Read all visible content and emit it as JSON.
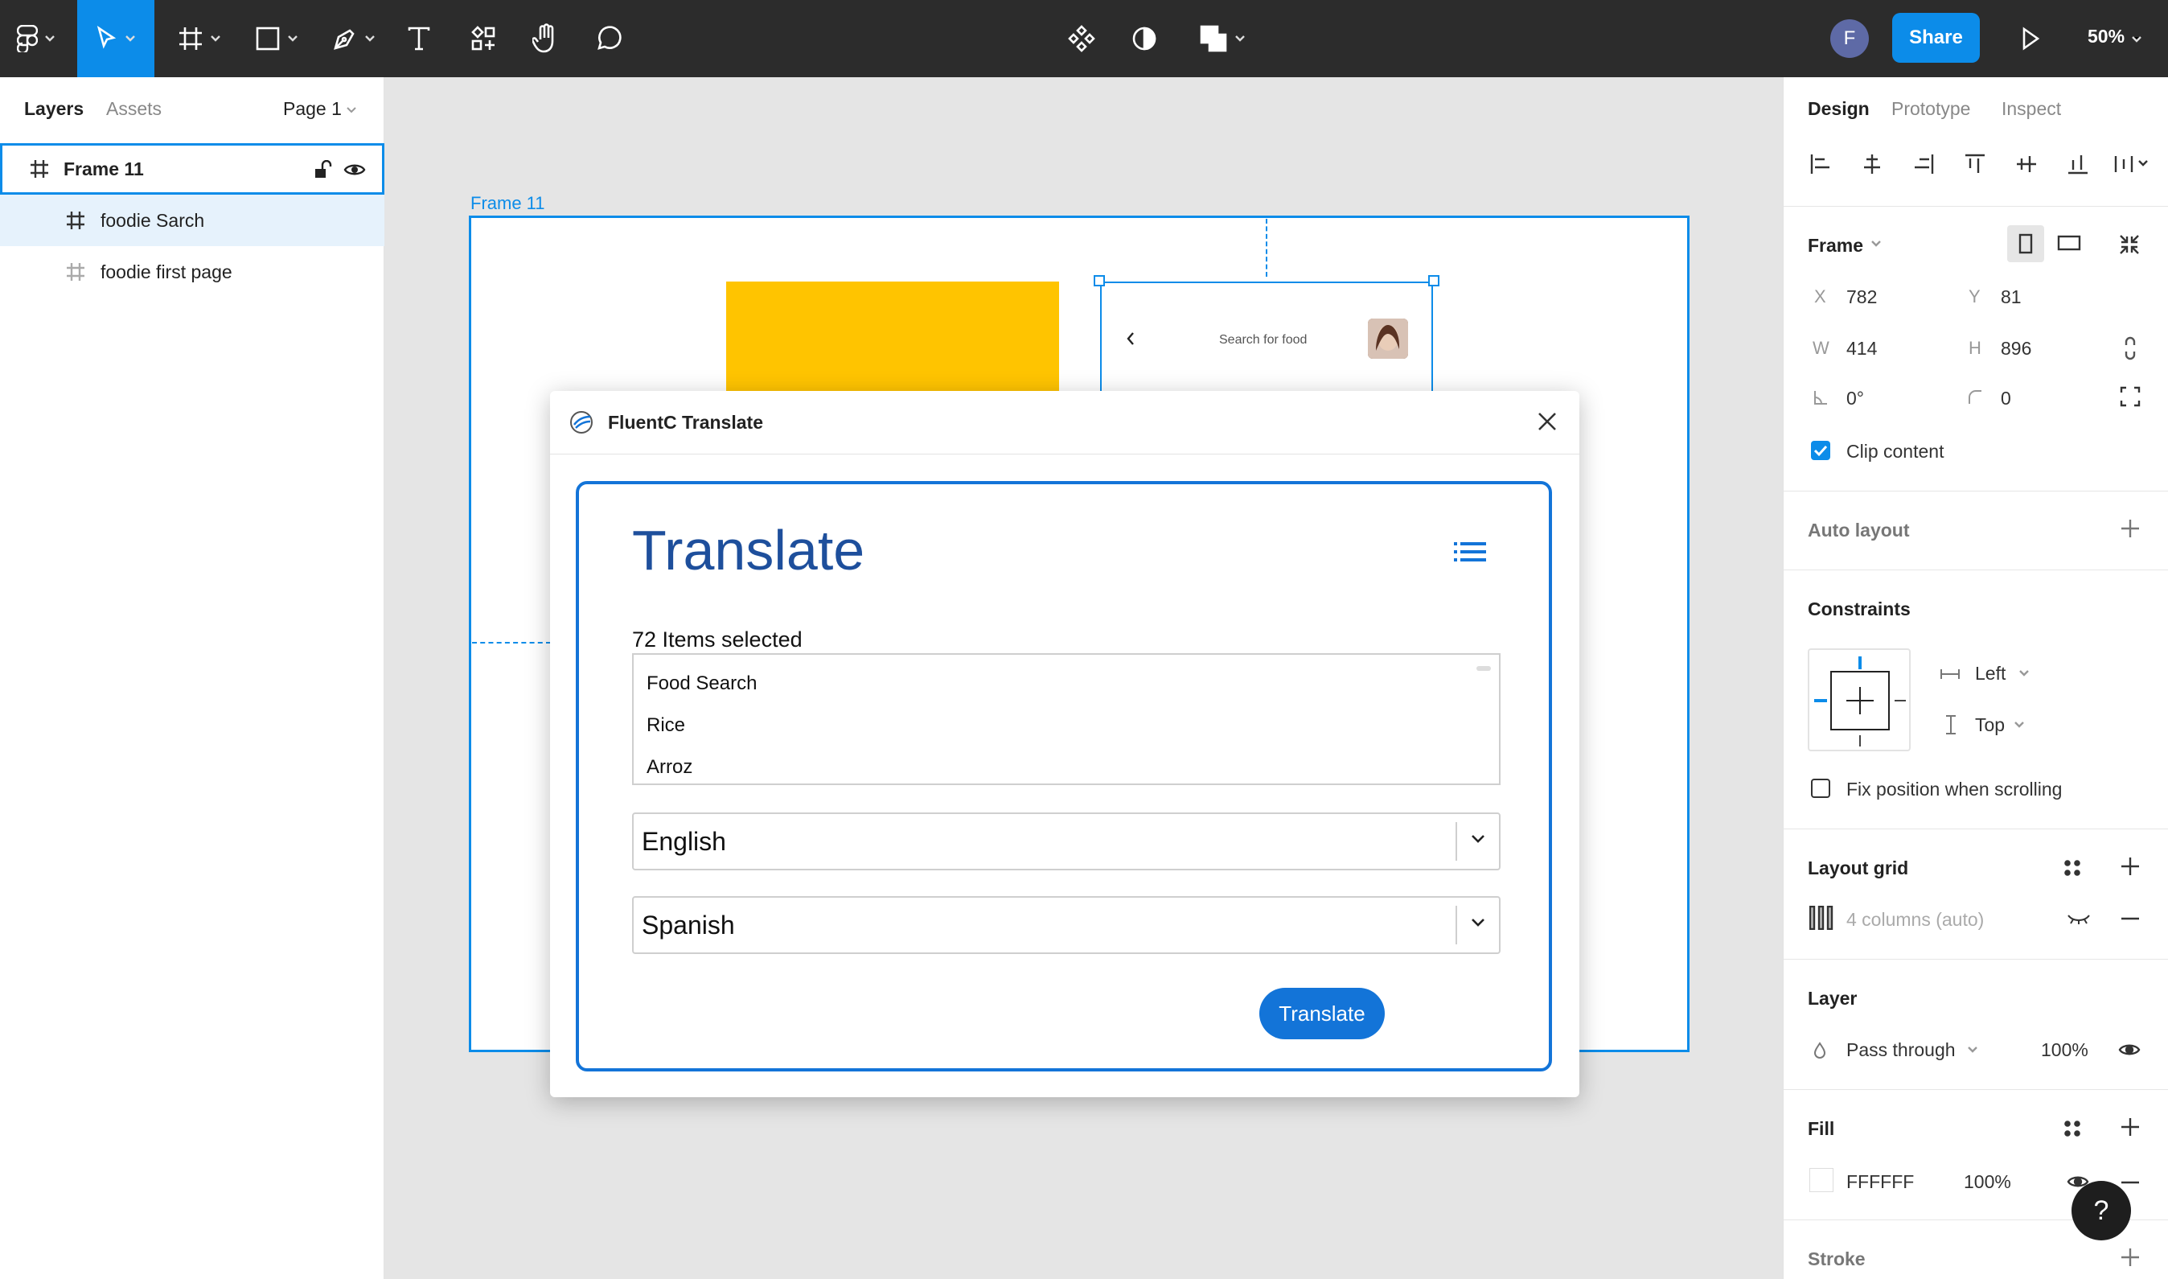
{
  "toolbar": {
    "avatar_initial": "F",
    "share_label": "Share",
    "zoom": "50%"
  },
  "left_panel": {
    "tabs": [
      "Layers",
      "Assets"
    ],
    "page_label": "Page 1",
    "layers": [
      {
        "name": "Frame 11"
      },
      {
        "name": "foodie Sarch"
      },
      {
        "name": "foodie first page"
      }
    ]
  },
  "canvas": {
    "frame_label": "Frame 11",
    "phone_search_text": "Search for food"
  },
  "plugin": {
    "title": "FluentC Translate",
    "heading": "Translate",
    "items_selected": "72 Items selected",
    "items": [
      "Food Search",
      "Rice",
      "Arroz"
    ],
    "source_language": "English",
    "target_language": "Spanish",
    "translate_button": "Translate"
  },
  "right_panel": {
    "tabs": [
      "Design",
      "Prototype",
      "Inspect"
    ],
    "frame": {
      "label": "Frame",
      "x_label": "X",
      "x": "782",
      "y_label": "Y",
      "y": "81",
      "w_label": "W",
      "w": "414",
      "h_label": "H",
      "h": "896",
      "rotation": "0°",
      "radius": "0",
      "clip_content": "Clip content"
    },
    "auto_layout": "Auto layout",
    "constraints": {
      "title": "Constraints",
      "horizontal": "Left",
      "vertical": "Top",
      "fix_position": "Fix position when scrolling"
    },
    "layout_grid": {
      "title": "Layout grid",
      "grid": "4 columns (auto)"
    },
    "layer": {
      "title": "Layer",
      "blend": "Pass through",
      "opacity": "100%"
    },
    "fill": {
      "title": "Fill",
      "hex": "FFFFFF",
      "opacity": "100%"
    },
    "stroke": {
      "title": "Stroke"
    }
  },
  "help_label": "?",
  "colors": {
    "toolbar_bg": "#2c2c2c",
    "accent": "#0c8ce9",
    "plugin_blue": "#1374d8",
    "heading_blue": "#1e4f9c",
    "yellow": "#ffc400"
  }
}
